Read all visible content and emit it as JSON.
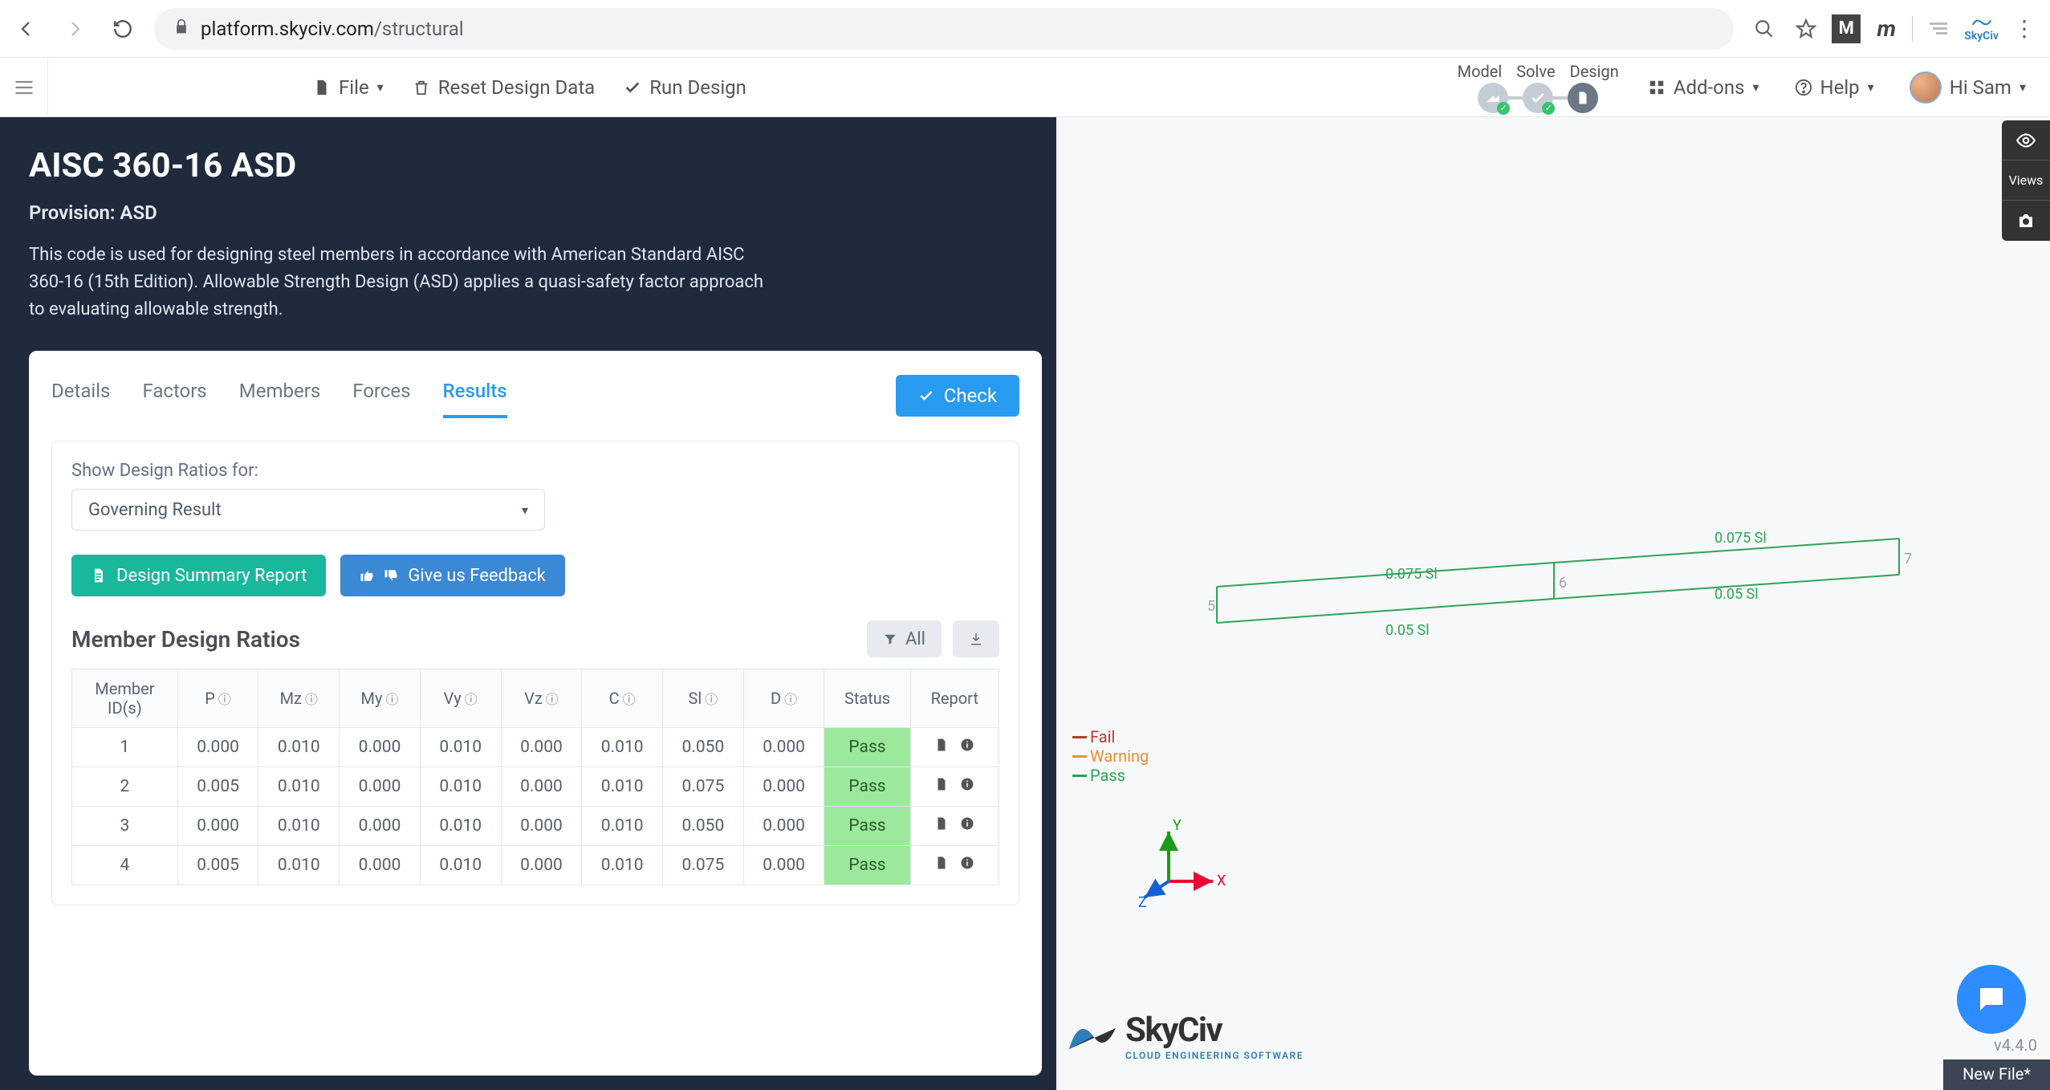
{
  "browser": {
    "url_host": "platform.skyciv.com",
    "url_path": "/structural",
    "ext_square": "M",
    "skyciv_label": "SkyCiv"
  },
  "toolbar": {
    "file": "File",
    "reset": "Reset Design Data",
    "run": "Run Design",
    "msd": {
      "model": "Model",
      "solve": "Solve",
      "design": "Design"
    },
    "addons": "Add-ons",
    "help": "Help",
    "user_greeting": "Hi Sam"
  },
  "view_toolbar": {
    "views": "Views"
  },
  "panel": {
    "title": "AISC 360-16 ASD",
    "provision": "Provision: ASD",
    "description": "This code is used for designing steel members in accordance with American Standard AISC 360-16 (15th Edition). Allowable Strength Design (ASD) applies a quasi-safety factor approach to evaluating allowable strength.",
    "tabs": [
      "Details",
      "Factors",
      "Members",
      "Forces",
      "Results"
    ],
    "active_tab": 4,
    "check": "Check",
    "ratios_label": "Show Design Ratios for:",
    "ratios_value": "Governing Result",
    "summary_btn": "Design Summary Report",
    "feedback_btn": "Give us Feedback",
    "section_title": "Member Design Ratios",
    "filter_all": "All",
    "columns": [
      "Member ID(s)",
      "P",
      "Mz",
      "My",
      "Vy",
      "Vz",
      "C",
      "Sl",
      "D",
      "Status",
      "Report"
    ],
    "info_cols": [
      false,
      true,
      true,
      true,
      true,
      true,
      true,
      true,
      true,
      false,
      false
    ],
    "rows": [
      {
        "id": "1",
        "P": "0.000",
        "Mz": "0.010",
        "My": "0.000",
        "Vy": "0.010",
        "Vz": "0.000",
        "C": "0.010",
        "Sl": "0.050",
        "D": "0.000",
        "Status": "Pass"
      },
      {
        "id": "2",
        "P": "0.005",
        "Mz": "0.010",
        "My": "0.000",
        "Vy": "0.010",
        "Vz": "0.000",
        "C": "0.010",
        "Sl": "0.075",
        "D": "0.000",
        "Status": "Pass"
      },
      {
        "id": "3",
        "P": "0.000",
        "Mz": "0.010",
        "My": "0.000",
        "Vy": "0.010",
        "Vz": "0.000",
        "C": "0.010",
        "Sl": "0.050",
        "D": "0.000",
        "Status": "Pass"
      },
      {
        "id": "4",
        "P": "0.005",
        "Mz": "0.010",
        "My": "0.000",
        "Vy": "0.010",
        "Vz": "0.000",
        "C": "0.010",
        "Sl": "0.075",
        "D": "0.000",
        "Status": "Pass"
      }
    ]
  },
  "viewport": {
    "legend": {
      "fail": "Fail",
      "warning": "Warning",
      "pass": "Pass"
    },
    "colors": {
      "fail": "#c0392b",
      "warning": "#e8902f",
      "pass": "#2fa457"
    },
    "member_labels": {
      "top_front": "0.075 Sl",
      "top_back": "0.075 Sl",
      "bot_front": "0.05 Sl",
      "bot_back": "0.05 Sl"
    },
    "node_labels": {
      "left": "5",
      "mid": "6",
      "right": "7"
    },
    "axes": {
      "x": "X",
      "y": "Y",
      "z": "Z"
    },
    "logo": {
      "name": "SkyCiv",
      "sub": "CLOUD ENGINEERING SOFTWARE"
    },
    "version": "v4.4.0",
    "file_tab": "New File*"
  }
}
